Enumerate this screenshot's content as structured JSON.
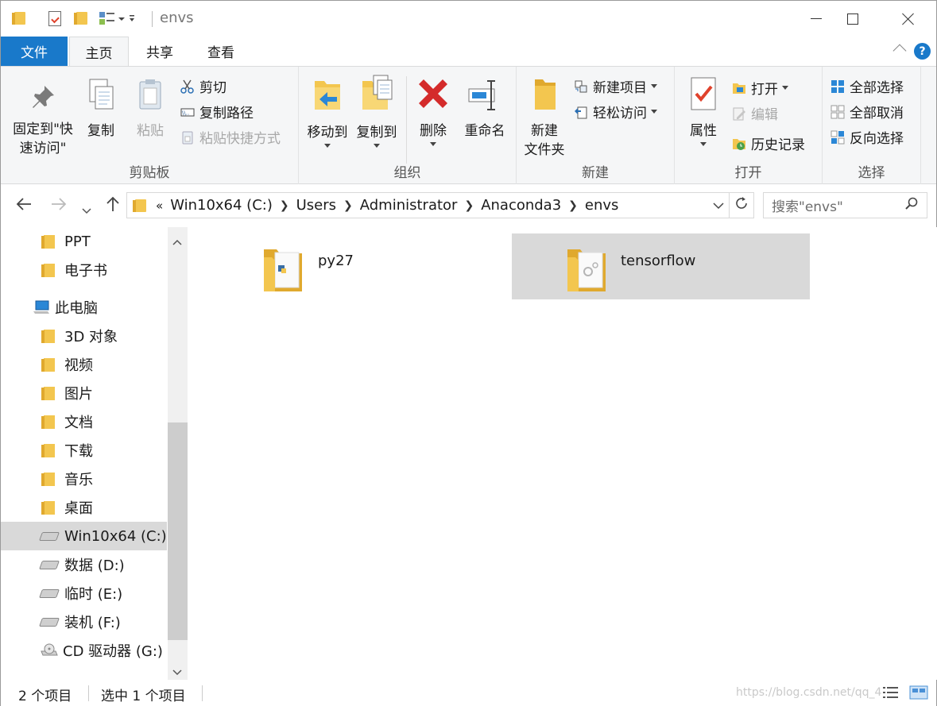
{
  "window": {
    "title": "envs"
  },
  "tabs": {
    "file": "文件",
    "home": "主页",
    "share": "共享",
    "view": "查看"
  },
  "help": "?",
  "ribbon": {
    "clipboard": {
      "label": "剪贴板",
      "pin_line1": "固定到\"快",
      "pin_line2": "速访问\"",
      "copy": "复制",
      "paste": "粘贴",
      "cut": "剪切",
      "copy_path": "复制路径",
      "paste_shortcut": "粘贴快捷方式"
    },
    "organize": {
      "label": "组织",
      "move_to": "移动到",
      "copy_to": "复制到",
      "delete": "删除",
      "rename": "重命名"
    },
    "new": {
      "label": "新建",
      "new_folder_line1": "新建",
      "new_folder_line2": "文件夹",
      "new_item": "新建项目",
      "easy_access": "轻松访问"
    },
    "open": {
      "label": "打开",
      "properties": "属性",
      "open": "打开",
      "edit": "编辑",
      "history": "历史记录"
    },
    "select": {
      "label": "选择",
      "select_all": "全部选择",
      "select_none": "全部取消",
      "invert": "反向选择"
    }
  },
  "address": {
    "overflow": "«",
    "crumbs": [
      "Win10x64 (C:)",
      "Users",
      "Administrator",
      "Anaconda3",
      "envs"
    ],
    "search_placeholder": "搜索\"envs\""
  },
  "nav": {
    "items": [
      "PPT",
      "电子书",
      "此电脑",
      "3D 对象",
      "视频",
      "图片",
      "文档",
      "下载",
      "音乐",
      "桌面",
      "Win10x64 (C:)",
      "数据 (D:)",
      "临时 (E:)",
      "装机 (F:)",
      "CD 驱动器 (G:)"
    ]
  },
  "files": [
    {
      "name": "py27",
      "selected": false
    },
    {
      "name": "tensorflow",
      "selected": true
    }
  ],
  "status": {
    "count": "2 个项目",
    "selected": "选中 1 个项目",
    "watermark": "https://blog.csdn.net/qq_4"
  },
  "colors": {
    "accent": "#1979ca",
    "folder": "#f3c64f",
    "selection": "#d9d9d9"
  }
}
